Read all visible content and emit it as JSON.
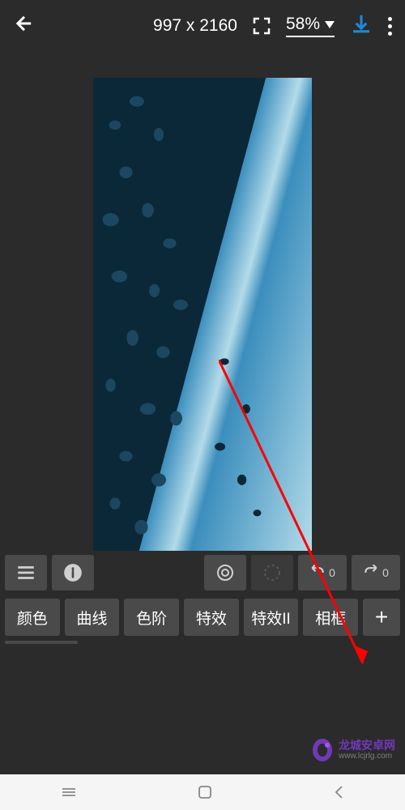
{
  "header": {
    "dimensions": "997 x 2160",
    "zoom": "58%"
  },
  "icon_row": {
    "undo_count": "0",
    "redo_count": "0"
  },
  "tools": {
    "color": "颜色",
    "curves": "曲线",
    "levels": "色阶",
    "effects": "特效",
    "effects2": "特效II",
    "frame": "相框"
  },
  "watermark": {
    "name": "龙城安卓网",
    "url": "www.lcjrlg.com"
  },
  "accent_blue": "#1e88d6"
}
